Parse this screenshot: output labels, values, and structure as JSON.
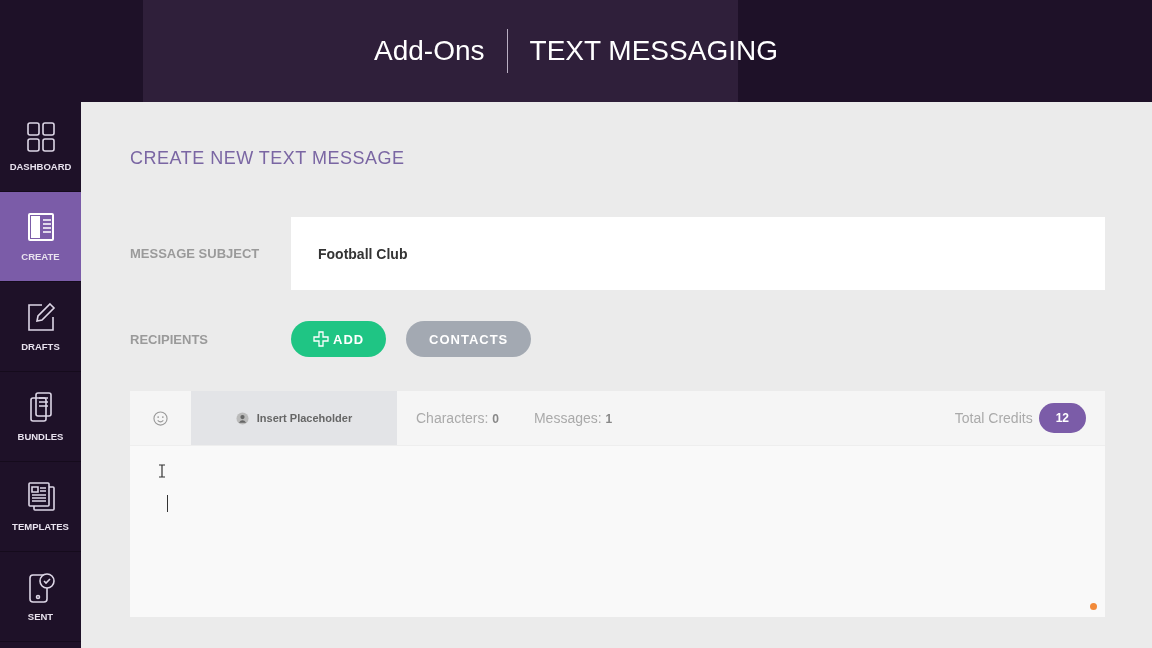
{
  "header": {
    "section": "Add-Ons",
    "title": "TEXT MESSAGING"
  },
  "sidebar": {
    "items": [
      {
        "label": "DASHBOARD",
        "kind": "dashboard",
        "selected": false
      },
      {
        "label": "CREATE",
        "kind": "create",
        "selected": true
      },
      {
        "label": "DRAFTS",
        "kind": "drafts",
        "selected": false
      },
      {
        "label": "BUNDLES",
        "kind": "bundles",
        "selected": false
      },
      {
        "label": "TEMPLATES",
        "kind": "templates",
        "selected": false
      },
      {
        "label": "SENT",
        "kind": "sent",
        "selected": false
      }
    ]
  },
  "page_title": "CREATE NEW TEXT MESSAGE",
  "subject": {
    "label": "MESSAGE SUBJECT",
    "value": "Football Club"
  },
  "recipients": {
    "label": "RECIPIENTS",
    "buttons": [
      {
        "label": "ADD",
        "kind": "add"
      },
      {
        "label": "CONTACTS",
        "kind": "contacts"
      }
    ]
  },
  "editor": {
    "placeholder_button": "Insert Placeholder",
    "characters_label": "Characters:",
    "characters": "0",
    "messages_label": "Messages:",
    "messages": "1",
    "credits_label": "Total Credits",
    "credits": "12"
  }
}
